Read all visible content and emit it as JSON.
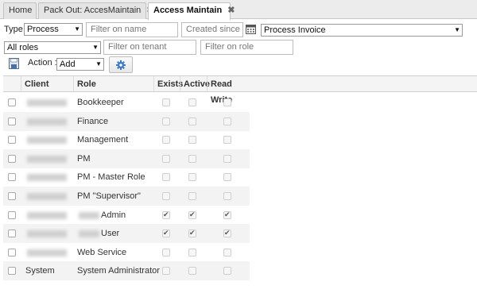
{
  "tabs": [
    {
      "label": "Home",
      "closable": false,
      "active": false
    },
    {
      "label": "Pack Out: AccesMaintain",
      "closable": true,
      "active": false
    },
    {
      "label": "Access Maintain",
      "closable": true,
      "active": true
    }
  ],
  "close_glyph": "✖",
  "filters": {
    "type_label": "Type",
    "type_value": "Process",
    "name_placeholder": "Filter on name",
    "created_placeholder": "Created since",
    "process_value": "Process Invoice",
    "roles_value": "All roles",
    "tenant_placeholder": "Filter on tenant",
    "role_placeholder": "Filter on role",
    "action_label": "Action :",
    "action_value": "Add"
  },
  "icons": {
    "calendar": "calendar-icon",
    "save": "save-icon",
    "settings": "gear-icon"
  },
  "grid": {
    "headers": [
      "Client",
      "Role",
      "Exists",
      "Active",
      "Read Write"
    ],
    "rows": [
      {
        "client": "",
        "client_blurred": true,
        "role": "Bookkeeper",
        "role_blurred_prefix": false,
        "exists": false,
        "active": false,
        "read_write": false
      },
      {
        "client": "",
        "client_blurred": true,
        "role": "Finance",
        "role_blurred_prefix": false,
        "exists": false,
        "active": false,
        "read_write": false
      },
      {
        "client": "",
        "client_blurred": true,
        "role": "Management",
        "role_blurred_prefix": false,
        "exists": false,
        "active": false,
        "read_write": false
      },
      {
        "client": "",
        "client_blurred": true,
        "role": "PM",
        "role_blurred_prefix": false,
        "exists": false,
        "active": false,
        "read_write": false
      },
      {
        "client": "",
        "client_blurred": true,
        "role": "PM - Master Role",
        "role_blurred_prefix": false,
        "exists": false,
        "active": false,
        "read_write": false
      },
      {
        "client": "",
        "client_blurred": true,
        "role": "PM \"Supervisor\"",
        "role_blurred_prefix": false,
        "exists": false,
        "active": false,
        "read_write": false
      },
      {
        "client": "",
        "client_blurred": true,
        "role": "Admin",
        "role_blurred_prefix": true,
        "exists": true,
        "active": true,
        "read_write": true
      },
      {
        "client": "",
        "client_blurred": true,
        "role": "User",
        "role_blurred_prefix": true,
        "exists": true,
        "active": true,
        "read_write": true
      },
      {
        "client": "",
        "client_blurred": true,
        "role": "Web Service",
        "role_blurred_prefix": false,
        "exists": false,
        "active": false,
        "read_write": false
      },
      {
        "client": "System",
        "client_blurred": false,
        "role": "System Administrator",
        "role_blurred_prefix": false,
        "exists": false,
        "active": false,
        "read_write": false
      }
    ]
  },
  "colors": {
    "settings_icon": "#3a78c9",
    "save_icon": "#4a6fa5"
  }
}
